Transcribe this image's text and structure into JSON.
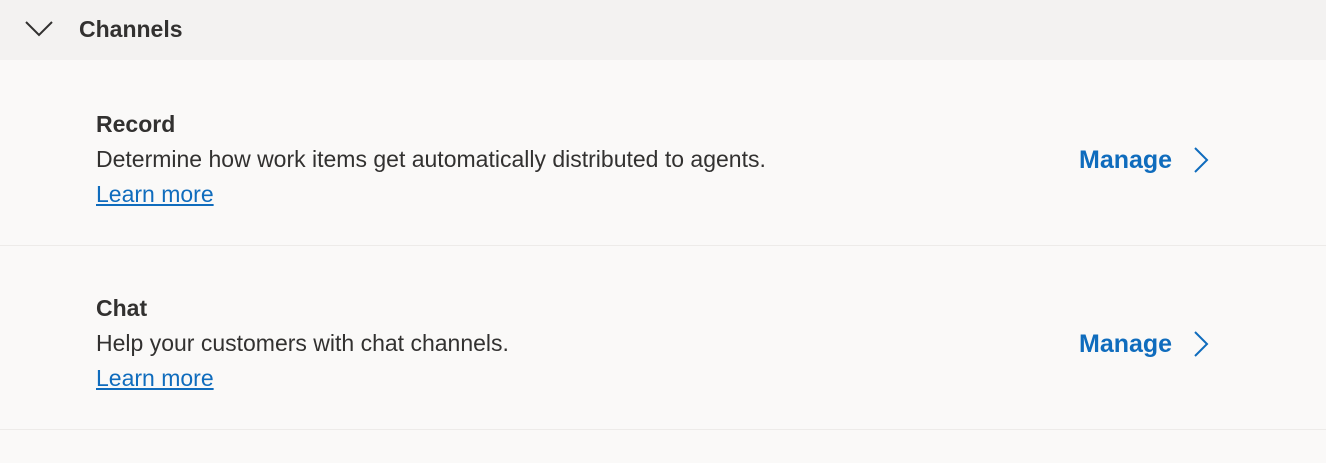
{
  "section": {
    "title": "Channels",
    "toggle_icon": "chevron-down-icon"
  },
  "items": [
    {
      "name": "Record",
      "description": "Determine how work items get automatically distributed to agents.",
      "learn_more": "Learn more",
      "action_label": "Manage",
      "action_icon": "chevron-right-icon"
    },
    {
      "name": "Chat",
      "description": "Help your customers with chat channels.",
      "learn_more": "Learn more",
      "action_label": "Manage",
      "action_icon": "chevron-right-icon"
    }
  ],
  "colors": {
    "accent": "#0f6cbd",
    "header_bg": "#f3f2f1",
    "page_bg": "#faf9f8",
    "text": "#323130"
  }
}
